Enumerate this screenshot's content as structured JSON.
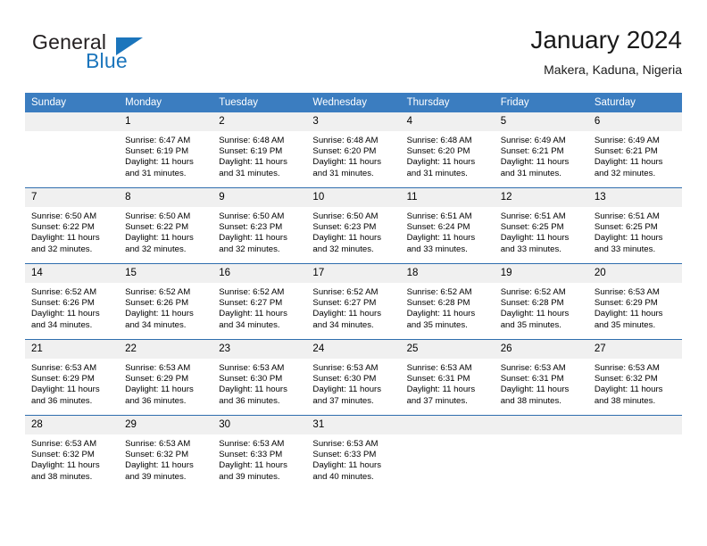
{
  "brand": {
    "name_part1": "General",
    "name_part2": "Blue"
  },
  "header": {
    "title": "January 2024",
    "subtitle": "Makera, Kaduna, Nigeria"
  },
  "colors": {
    "header_blue": "#3b7dc0",
    "brand_blue": "#1b75bc",
    "daynum_bg": "#f0f0f0",
    "row_divider": "#2f6eae"
  },
  "weekday_headers": [
    "Sunday",
    "Monday",
    "Tuesday",
    "Wednesday",
    "Thursday",
    "Friday",
    "Saturday"
  ],
  "weeks": [
    [
      {
        "day": "",
        "sunrise": "",
        "sunset": "",
        "daylight1": "",
        "daylight2": ""
      },
      {
        "day": "1",
        "sunrise": "Sunrise: 6:47 AM",
        "sunset": "Sunset: 6:19 PM",
        "daylight1": "Daylight: 11 hours",
        "daylight2": "and 31 minutes."
      },
      {
        "day": "2",
        "sunrise": "Sunrise: 6:48 AM",
        "sunset": "Sunset: 6:19 PM",
        "daylight1": "Daylight: 11 hours",
        "daylight2": "and 31 minutes."
      },
      {
        "day": "3",
        "sunrise": "Sunrise: 6:48 AM",
        "sunset": "Sunset: 6:20 PM",
        "daylight1": "Daylight: 11 hours",
        "daylight2": "and 31 minutes."
      },
      {
        "day": "4",
        "sunrise": "Sunrise: 6:48 AM",
        "sunset": "Sunset: 6:20 PM",
        "daylight1": "Daylight: 11 hours",
        "daylight2": "and 31 minutes."
      },
      {
        "day": "5",
        "sunrise": "Sunrise: 6:49 AM",
        "sunset": "Sunset: 6:21 PM",
        "daylight1": "Daylight: 11 hours",
        "daylight2": "and 31 minutes."
      },
      {
        "day": "6",
        "sunrise": "Sunrise: 6:49 AM",
        "sunset": "Sunset: 6:21 PM",
        "daylight1": "Daylight: 11 hours",
        "daylight2": "and 32 minutes."
      }
    ],
    [
      {
        "day": "7",
        "sunrise": "Sunrise: 6:50 AM",
        "sunset": "Sunset: 6:22 PM",
        "daylight1": "Daylight: 11 hours",
        "daylight2": "and 32 minutes."
      },
      {
        "day": "8",
        "sunrise": "Sunrise: 6:50 AM",
        "sunset": "Sunset: 6:22 PM",
        "daylight1": "Daylight: 11 hours",
        "daylight2": "and 32 minutes."
      },
      {
        "day": "9",
        "sunrise": "Sunrise: 6:50 AM",
        "sunset": "Sunset: 6:23 PM",
        "daylight1": "Daylight: 11 hours",
        "daylight2": "and 32 minutes."
      },
      {
        "day": "10",
        "sunrise": "Sunrise: 6:50 AM",
        "sunset": "Sunset: 6:23 PM",
        "daylight1": "Daylight: 11 hours",
        "daylight2": "and 32 minutes."
      },
      {
        "day": "11",
        "sunrise": "Sunrise: 6:51 AM",
        "sunset": "Sunset: 6:24 PM",
        "daylight1": "Daylight: 11 hours",
        "daylight2": "and 33 minutes."
      },
      {
        "day": "12",
        "sunrise": "Sunrise: 6:51 AM",
        "sunset": "Sunset: 6:25 PM",
        "daylight1": "Daylight: 11 hours",
        "daylight2": "and 33 minutes."
      },
      {
        "day": "13",
        "sunrise": "Sunrise: 6:51 AM",
        "sunset": "Sunset: 6:25 PM",
        "daylight1": "Daylight: 11 hours",
        "daylight2": "and 33 minutes."
      }
    ],
    [
      {
        "day": "14",
        "sunrise": "Sunrise: 6:52 AM",
        "sunset": "Sunset: 6:26 PM",
        "daylight1": "Daylight: 11 hours",
        "daylight2": "and 34 minutes."
      },
      {
        "day": "15",
        "sunrise": "Sunrise: 6:52 AM",
        "sunset": "Sunset: 6:26 PM",
        "daylight1": "Daylight: 11 hours",
        "daylight2": "and 34 minutes."
      },
      {
        "day": "16",
        "sunrise": "Sunrise: 6:52 AM",
        "sunset": "Sunset: 6:27 PM",
        "daylight1": "Daylight: 11 hours",
        "daylight2": "and 34 minutes."
      },
      {
        "day": "17",
        "sunrise": "Sunrise: 6:52 AM",
        "sunset": "Sunset: 6:27 PM",
        "daylight1": "Daylight: 11 hours",
        "daylight2": "and 34 minutes."
      },
      {
        "day": "18",
        "sunrise": "Sunrise: 6:52 AM",
        "sunset": "Sunset: 6:28 PM",
        "daylight1": "Daylight: 11 hours",
        "daylight2": "and 35 minutes."
      },
      {
        "day": "19",
        "sunrise": "Sunrise: 6:52 AM",
        "sunset": "Sunset: 6:28 PM",
        "daylight1": "Daylight: 11 hours",
        "daylight2": "and 35 minutes."
      },
      {
        "day": "20",
        "sunrise": "Sunrise: 6:53 AM",
        "sunset": "Sunset: 6:29 PM",
        "daylight1": "Daylight: 11 hours",
        "daylight2": "and 35 minutes."
      }
    ],
    [
      {
        "day": "21",
        "sunrise": "Sunrise: 6:53 AM",
        "sunset": "Sunset: 6:29 PM",
        "daylight1": "Daylight: 11 hours",
        "daylight2": "and 36 minutes."
      },
      {
        "day": "22",
        "sunrise": "Sunrise: 6:53 AM",
        "sunset": "Sunset: 6:29 PM",
        "daylight1": "Daylight: 11 hours",
        "daylight2": "and 36 minutes."
      },
      {
        "day": "23",
        "sunrise": "Sunrise: 6:53 AM",
        "sunset": "Sunset: 6:30 PM",
        "daylight1": "Daylight: 11 hours",
        "daylight2": "and 36 minutes."
      },
      {
        "day": "24",
        "sunrise": "Sunrise: 6:53 AM",
        "sunset": "Sunset: 6:30 PM",
        "daylight1": "Daylight: 11 hours",
        "daylight2": "and 37 minutes."
      },
      {
        "day": "25",
        "sunrise": "Sunrise: 6:53 AM",
        "sunset": "Sunset: 6:31 PM",
        "daylight1": "Daylight: 11 hours",
        "daylight2": "and 37 minutes."
      },
      {
        "day": "26",
        "sunrise": "Sunrise: 6:53 AM",
        "sunset": "Sunset: 6:31 PM",
        "daylight1": "Daylight: 11 hours",
        "daylight2": "and 38 minutes."
      },
      {
        "day": "27",
        "sunrise": "Sunrise: 6:53 AM",
        "sunset": "Sunset: 6:32 PM",
        "daylight1": "Daylight: 11 hours",
        "daylight2": "and 38 minutes."
      }
    ],
    [
      {
        "day": "28",
        "sunrise": "Sunrise: 6:53 AM",
        "sunset": "Sunset: 6:32 PM",
        "daylight1": "Daylight: 11 hours",
        "daylight2": "and 38 minutes."
      },
      {
        "day": "29",
        "sunrise": "Sunrise: 6:53 AM",
        "sunset": "Sunset: 6:32 PM",
        "daylight1": "Daylight: 11 hours",
        "daylight2": "and 39 minutes."
      },
      {
        "day": "30",
        "sunrise": "Sunrise: 6:53 AM",
        "sunset": "Sunset: 6:33 PM",
        "daylight1": "Daylight: 11 hours",
        "daylight2": "and 39 minutes."
      },
      {
        "day": "31",
        "sunrise": "Sunrise: 6:53 AM",
        "sunset": "Sunset: 6:33 PM",
        "daylight1": "Daylight: 11 hours",
        "daylight2": "and 40 minutes."
      },
      {
        "day": "",
        "sunrise": "",
        "sunset": "",
        "daylight1": "",
        "daylight2": ""
      },
      {
        "day": "",
        "sunrise": "",
        "sunset": "",
        "daylight1": "",
        "daylight2": ""
      },
      {
        "day": "",
        "sunrise": "",
        "sunset": "",
        "daylight1": "",
        "daylight2": ""
      }
    ]
  ]
}
